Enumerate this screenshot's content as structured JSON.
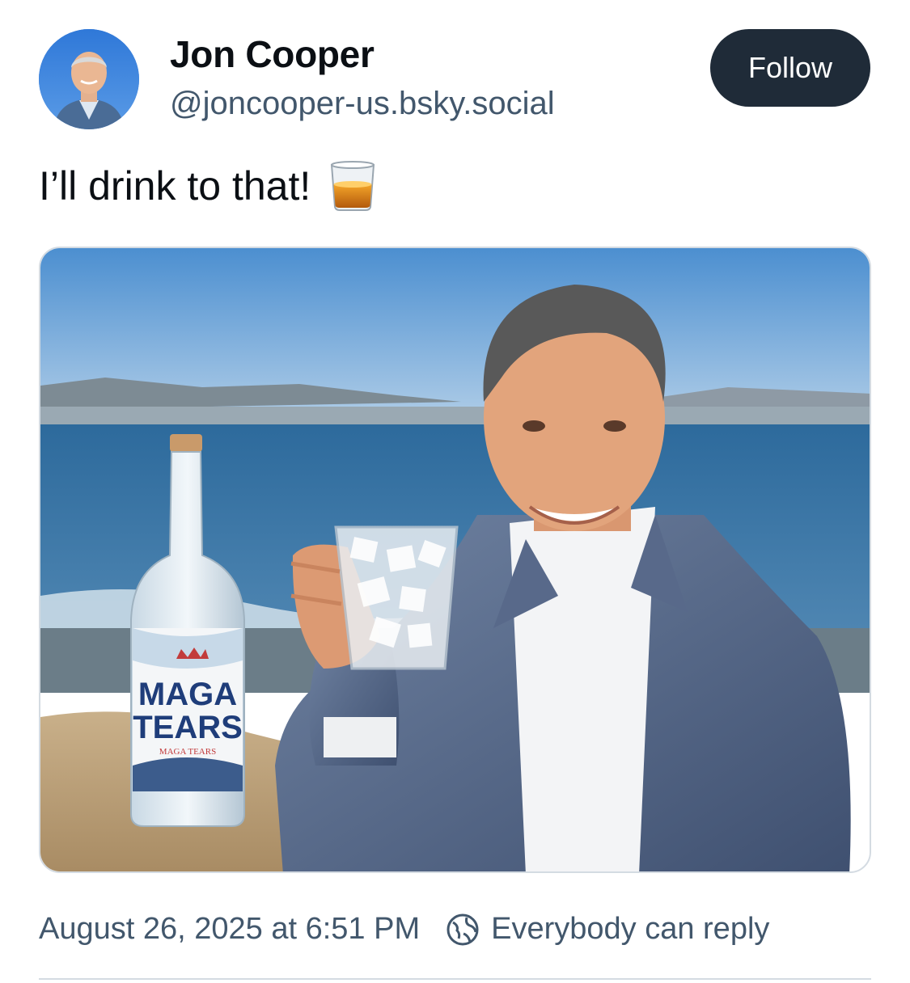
{
  "author": {
    "name": "Jon Cooper",
    "handle": "@joncooper-us.bsky.social",
    "avatar_icon": "avatar-photo"
  },
  "follow_button": {
    "label": "Follow"
  },
  "post": {
    "text": "I’ll drink to that!",
    "emoji": "tumbler-glass-emoji",
    "image": {
      "bottle_label_line1": "MAGA",
      "bottle_label_line2": "TEARS",
      "bottle_small_text": "MAGA TEARS"
    }
  },
  "meta": {
    "timestamp": "August 26, 2025 at 6:51 PM",
    "reply_setting": "Everybody can reply",
    "reply_icon": "globe-icon"
  },
  "colors": {
    "follow_bg": "#1f2b38",
    "secondary_text": "#42576c",
    "border": "#d4dbe2"
  }
}
